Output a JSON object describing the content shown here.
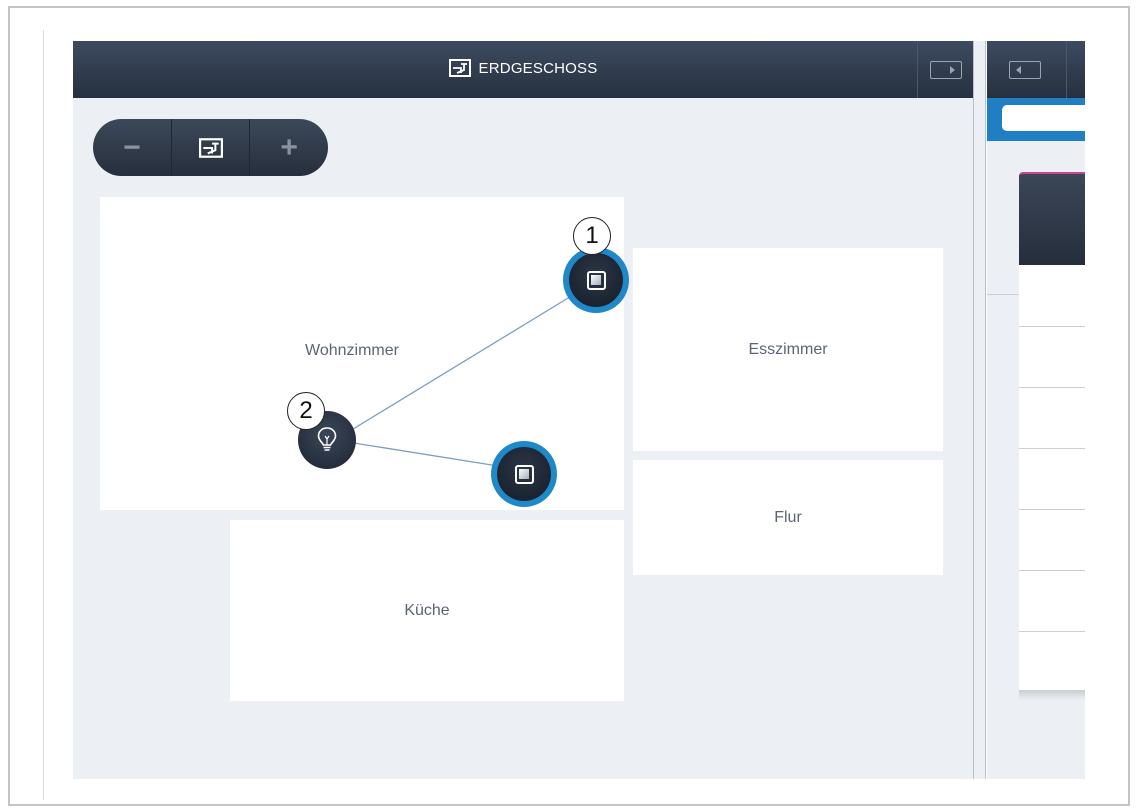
{
  "header": {
    "title": "ERDGESCHOSS",
    "title_icon": "floorplan-icon",
    "toggle_right_icon": "panel-collapse-right-icon"
  },
  "zoom_controls": {
    "minus": "−",
    "plus": "+",
    "fit_icon": "floorplan-icon"
  },
  "rooms": [
    {
      "id": "wohnzimmer",
      "label": "Wohnzimmer"
    },
    {
      "id": "esszimmer",
      "label": "Esszimmer"
    },
    {
      "id": "flur",
      "label": "Flur"
    },
    {
      "id": "kueche",
      "label": "Küche"
    }
  ],
  "devices": [
    {
      "id": "switch-1",
      "type": "switch",
      "icon": "square-switch-icon"
    },
    {
      "id": "switch-2",
      "type": "switch",
      "icon": "square-switch-icon"
    },
    {
      "id": "lamp",
      "type": "light",
      "icon": "lightbulb-icon"
    }
  ],
  "callouts": {
    "one": "1",
    "two": "2"
  },
  "right_panel": {
    "toggle_icon": "panel-expand-left-icon",
    "accent_color": "#1f7fc2"
  },
  "colors": {
    "header": "#2f3a4b",
    "device_ring": "#1e88c8",
    "canvas": "#eceff3",
    "room": "#ffffff"
  }
}
